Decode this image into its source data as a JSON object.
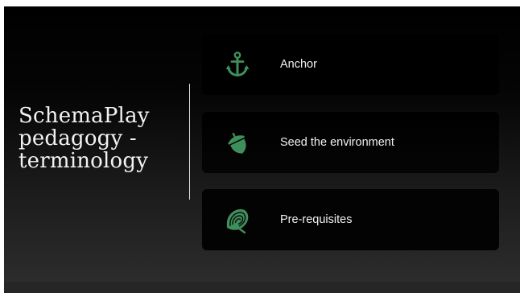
{
  "slide": {
    "title_lines": [
      "SchemaPlay",
      "pedagogy -",
      "terminology"
    ],
    "accent_color": "#3f8f5a",
    "items": [
      {
        "label": "Anchor",
        "icon": "anchor-icon"
      },
      {
        "label": "Seed the environment",
        "icon": "acorn-icon"
      },
      {
        "label": "Pre-requisites",
        "icon": "onion-icon"
      }
    ]
  }
}
